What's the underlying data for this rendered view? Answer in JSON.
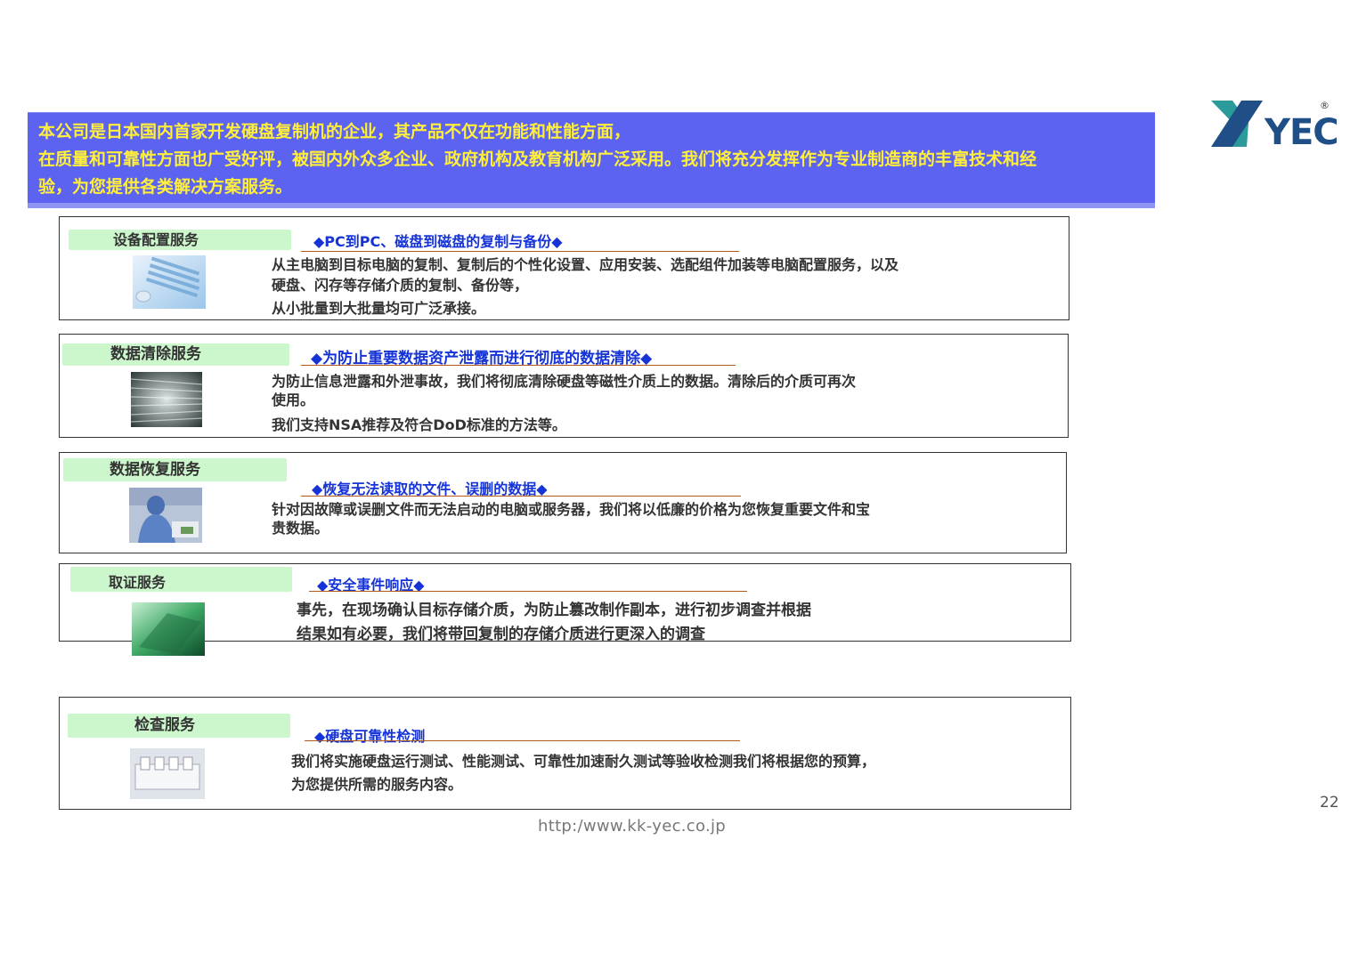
{
  "intro": {
    "lines": [
      "本公司是日本国内首家开发硬盘复制机的企业，其产品不仅在功能和性能方面，",
      "在质量和可靠性方面也广受好评，被国内外众多企业、政府机构及教育机构广泛采用。我们将充分发挥作为专业制造商的丰富技术和经",
      "验，为您提供各类解决方案服务。"
    ]
  },
  "logo": {
    "text": "YEC",
    "registered": "®",
    "colors": {
      "dark": "#1f4f86",
      "accent": "#2a9a9a"
    }
  },
  "services": [
    {
      "tab": "设备配置服务",
      "headline": "◆PC到PC、磁盘到磁盘的复制与备份◆",
      "description": [
        "从主电脑到目标电脑的复制、复制后的个性化设置、应用安装、选配组件加装等电脑配置服务，以及",
        "硬盘、闪存等存储介质的复制、备份等，",
        "从小批量到大批量均可广泛承接。"
      ],
      "image_icon": "keyboard-photo"
    },
    {
      "tab": "数据清除服务",
      "headline": "◆为防止重要数据资产泄露而进行彻底的数据清除◆",
      "description": [
        "为防止信息泄露和外泄事故，我们将彻底清除硬盘等磁性介质上的数据。清除后的介质可再次",
        "使用。",
        "我们支持NSA推荐及符合DoD标准的方法等。"
      ],
      "image_icon": "data-stream-photo"
    },
    {
      "tab": "数据恢复服务",
      "headline": "◆恢复无法读取的文件、误删的数据◆",
      "description": [
        "针对因故障或误删文件而无法启动的电脑或服务器，我们将以低廉的价格为您恢复重要文件和宝",
        "贵数据。"
      ],
      "image_icon": "technician-photo"
    },
    {
      "tab": "取证服务",
      "headline": "◆安全事件响应◆",
      "description": [
        "事先，在现场确认目标存储介质，为防止篡改制作副本，进行初步调查并根据",
        "结果如有必要，我们将带回复制的存储介质进行更深入的调查"
      ],
      "image_icon": "laptop-photo"
    },
    {
      "tab": "检查服务",
      "headline": "◆硬盘可靠性检测",
      "description": [
        "我们将实施硬盘运行测试、性能测试、可靠性加速耐久测试等验收检测我们将根据您的预算，",
        "为您提供所需的服务内容。"
      ],
      "image_icon": "test-equipment-photo"
    }
  ],
  "page_number": "22",
  "footer_url": "http:/www.kk-yec.co.jp"
}
